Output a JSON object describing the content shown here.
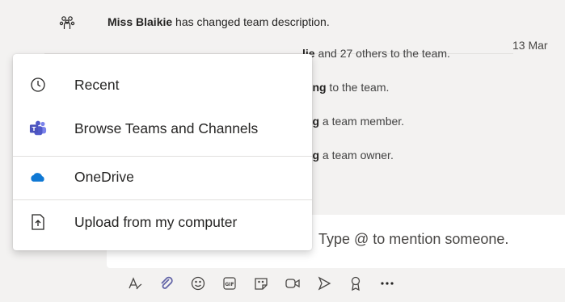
{
  "feed": {
    "row1": {
      "actor": "Miss Blaikie",
      "rest": " has changed team description."
    },
    "date": "13 Mar",
    "row2": {
      "name_tail": "lie",
      "rest": " and 27 others to the team."
    },
    "row3": {
      "name_tail": "ning",
      "rest": " to the team."
    },
    "row4": {
      "name_tail": "ing",
      "rest": " a team member."
    },
    "row5": {
      "name_tail": "ing",
      "rest": " a team owner."
    }
  },
  "menu": {
    "items": [
      {
        "label": "Recent",
        "icon": "clock-icon"
      },
      {
        "label": "Browse Teams and Channels",
        "icon": "teams-icon"
      },
      {
        "label": "OneDrive",
        "icon": "onedrive-icon"
      },
      {
        "label": "Upload from my computer",
        "icon": "upload-icon"
      }
    ]
  },
  "compose": {
    "placeholder": "Type @ to mention someone."
  },
  "colors": {
    "accent": "#6264a7",
    "onedrive": "#0f78d4",
    "teams_purple": "#5059c9"
  }
}
